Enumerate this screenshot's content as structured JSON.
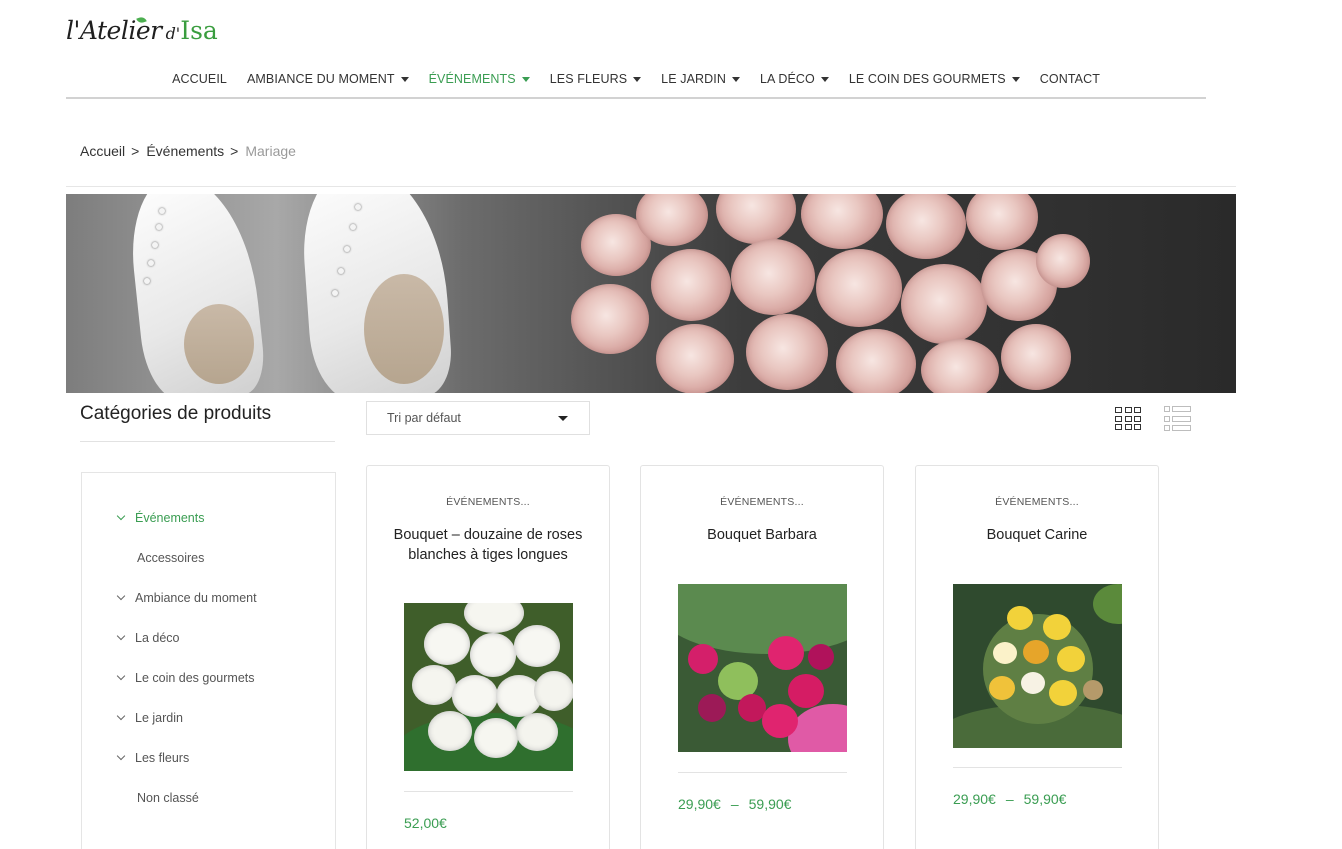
{
  "logo": {
    "main": "l'Atelier",
    "small": "d'",
    "accent": "Isa"
  },
  "nav": {
    "items": [
      {
        "label": "ACCUEIL",
        "dropdown": false,
        "active": false
      },
      {
        "label": "AMBIANCE DU MOMENT",
        "dropdown": true,
        "active": false
      },
      {
        "label": "ÉVÉNEMENTS",
        "dropdown": true,
        "active": true
      },
      {
        "label": "LES FLEURS",
        "dropdown": true,
        "active": false
      },
      {
        "label": "LE JARDIN",
        "dropdown": true,
        "active": false
      },
      {
        "label": "LA DÉCO",
        "dropdown": true,
        "active": false
      },
      {
        "label": "LE COIN DES GOURMETS",
        "dropdown": true,
        "active": false
      },
      {
        "label": "CONTACT",
        "dropdown": false,
        "active": false
      }
    ]
  },
  "breadcrumb": {
    "home": "Accueil",
    "section": "Événements",
    "current": "Mariage",
    "separator": ">"
  },
  "sidebar": {
    "title": "Catégories de produits",
    "categories": [
      {
        "label": "Événements",
        "expandable": true,
        "active": true
      },
      {
        "label": "Accessoires",
        "expandable": false,
        "active": false
      },
      {
        "label": "Ambiance du moment",
        "expandable": true,
        "active": false
      },
      {
        "label": "La déco",
        "expandable": true,
        "active": false
      },
      {
        "label": "Le coin des gourmets",
        "expandable": true,
        "active": false
      },
      {
        "label": "Le jardin",
        "expandable": true,
        "active": false
      },
      {
        "label": "Les fleurs",
        "expandable": true,
        "active": false
      },
      {
        "label": "Non classé",
        "expandable": false,
        "active": false
      }
    ]
  },
  "sort": {
    "selected": "Tri par défaut"
  },
  "view": {
    "grid_icon": "grid-view-icon",
    "list_icon": "list-view-icon",
    "active": "grid"
  },
  "products": [
    {
      "category": "ÉVÉNEMENTS...",
      "title": "Bouquet – douzaine de roses blanches à tiges longues",
      "price_from": "52,00€",
      "price_to": ""
    },
    {
      "category": "ÉVÉNEMENTS...",
      "title": "Bouquet Barbara",
      "price_from": "29,90€",
      "price_to": "59,90€"
    },
    {
      "category": "ÉVÉNEMENTS...",
      "title": "Bouquet Carine",
      "price_from": "29,90€",
      "price_to": "59,90€"
    }
  ],
  "colors": {
    "accent": "#3a9d52",
    "text": "#333333",
    "muted": "#9a9a9a",
    "border": "#e3e3e3"
  }
}
